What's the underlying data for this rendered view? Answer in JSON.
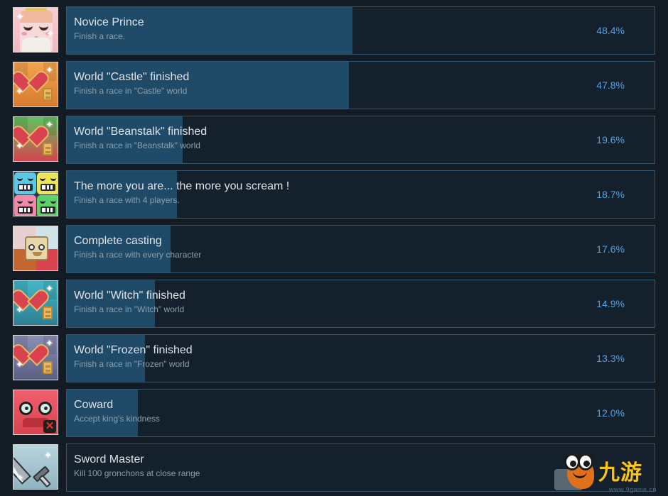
{
  "theme": {
    "page_background": "#131c25",
    "row_background": "#14202c",
    "row_border": "#33586f",
    "progress_fill": "#1f4a68",
    "title_color": "#dfe3e6",
    "desc_color": "#8ba0ad",
    "percent_color": "#4fa3e3"
  },
  "achievements": [
    {
      "title": "Novice Prince",
      "description": "Finish a race.",
      "percent_label": "48.4%",
      "percent_value": 48.4,
      "icon": "prince-head-icon"
    },
    {
      "title": "World \"Castle\" finished",
      "description": "Finish a race in \"Castle\" world",
      "percent_label": "47.8%",
      "percent_value": 47.8,
      "icon": "castle-heart-key-icon"
    },
    {
      "title": "World \"Beanstalk\" finished",
      "description": "Finish a race in \"Beanstalk\" world",
      "percent_label": "19.6%",
      "percent_value": 19.6,
      "icon": "beanstalk-heart-key-icon"
    },
    {
      "title": "The more you are... the more you scream !",
      "description": "Finish a race with 4 players.",
      "percent_label": "18.7%",
      "percent_value": 18.7,
      "icon": "four-faces-icon"
    },
    {
      "title": "Complete casting",
      "description": "Finish a race with every character",
      "percent_label": "17.6%",
      "percent_value": 17.6,
      "icon": "character-collage-icon"
    },
    {
      "title": "World \"Witch\" finished",
      "description": "Finish a race in \"Witch\" world",
      "percent_label": "14.9%",
      "percent_value": 14.9,
      "icon": "witch-heart-key-icon"
    },
    {
      "title": "World \"Frozen\" finished",
      "description": "Finish a race in \"Frozen\" world",
      "percent_label": "13.3%",
      "percent_value": 13.3,
      "icon": "frozen-heart-key-icon"
    },
    {
      "title": "Coward",
      "description": "Accept king's kindness",
      "percent_label": "12.0%",
      "percent_value": 12.0,
      "icon": "red-monster-icon"
    },
    {
      "title": "Sword Master",
      "description": "Kill 100 gronchons at close range",
      "percent_label": "",
      "percent_value": 0,
      "icon": "sword-icon"
    }
  ],
  "watermark": {
    "logo_text": "九游",
    "url_text": "www.9game.cn"
  }
}
